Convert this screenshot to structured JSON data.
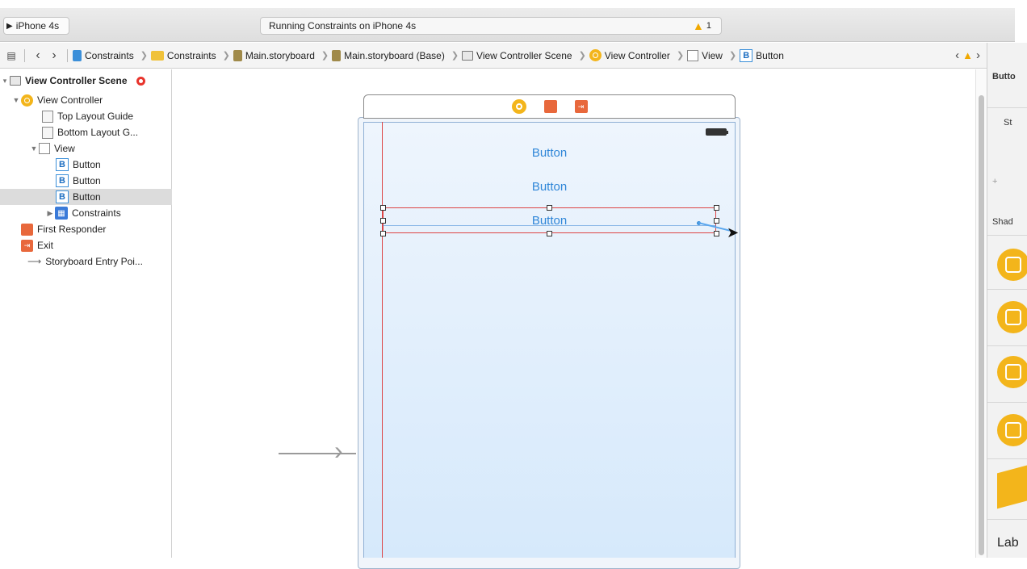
{
  "toolbar": {
    "scheme_device": "iPhone 4s",
    "activity_text": "Running Constraints on iPhone 4s",
    "warning_count": "1"
  },
  "jumpbar": {
    "crumbs": [
      "Constraints",
      "Constraints",
      "Main.storyboard",
      "Main.storyboard (Base)",
      "View Controller Scene",
      "View Controller",
      "View",
      "Button"
    ]
  },
  "outline": {
    "scene_title": "View Controller Scene",
    "view_controller": "View Controller",
    "top_layout_guide": "Top Layout Guide",
    "bottom_layout_guide": "Bottom Layout G...",
    "view": "View",
    "button_1": "Button",
    "button_2": "Button",
    "button_3": "Button",
    "constraints": "Constraints",
    "first_responder": "First Responder",
    "exit": "Exit",
    "storyboard_entry": "Storyboard Entry Poi..."
  },
  "canvas": {
    "button_labels": [
      "Button",
      "Button",
      "Button"
    ]
  },
  "inspector": {
    "title": "Butto",
    "st": "St",
    "plus": "+",
    "shad": "Shad",
    "lab": "Lab"
  },
  "colors": {
    "accent_blue": "#2f86d8",
    "constraint_red": "#dd4444",
    "warning_yellow": "#f0a800",
    "vc_yellow": "#f3b51b",
    "exit_orange": "#e8683c"
  }
}
